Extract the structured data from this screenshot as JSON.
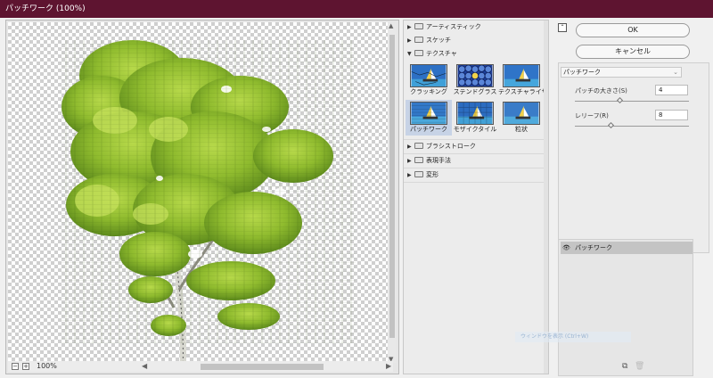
{
  "window": {
    "title": "パッチワーク (100%)"
  },
  "preview": {
    "zoom_label": "100%",
    "zoom_out_icon": "minus-icon",
    "zoom_in_icon": "plus-icon"
  },
  "gallery": {
    "categories": [
      {
        "label": "アーティスティック",
        "expanded": false
      },
      {
        "label": "スケッチ",
        "expanded": false
      },
      {
        "label": "テクスチャ",
        "expanded": true
      },
      {
        "label": "ブラシストローク",
        "expanded": false
      },
      {
        "label": "表現手法",
        "expanded": false
      },
      {
        "label": "変形",
        "expanded": false
      }
    ],
    "texture_thumbs": [
      {
        "label": "クラッキング",
        "selected": false
      },
      {
        "label": "ステンドグラス",
        "selected": false
      },
      {
        "label": "テクスチャライザー",
        "selected": false
      },
      {
        "label": "パッチワーク",
        "selected": true
      },
      {
        "label": "モザイクタイル",
        "selected": false
      },
      {
        "label": "粒状",
        "selected": false
      }
    ]
  },
  "panel": {
    "ok_label": "OK",
    "cancel_label": "キャンセル",
    "filter_select": "パッチワーク",
    "params": [
      {
        "label": "パッチの大きさ(S)",
        "value": "4",
        "slider_fraction": 0.4
      },
      {
        "label": "レリーフ(R)",
        "value": "8",
        "slider_fraction": 0.32
      }
    ]
  },
  "layers": {
    "items": [
      {
        "name": "パッチワーク",
        "visible": true
      }
    ]
  },
  "tooltip": {
    "text": "ウィンドウを表示 (Ctrl+W)"
  },
  "colors": {
    "titlebar": "#5e1430",
    "selected_thumb": "#c7d3e6"
  }
}
